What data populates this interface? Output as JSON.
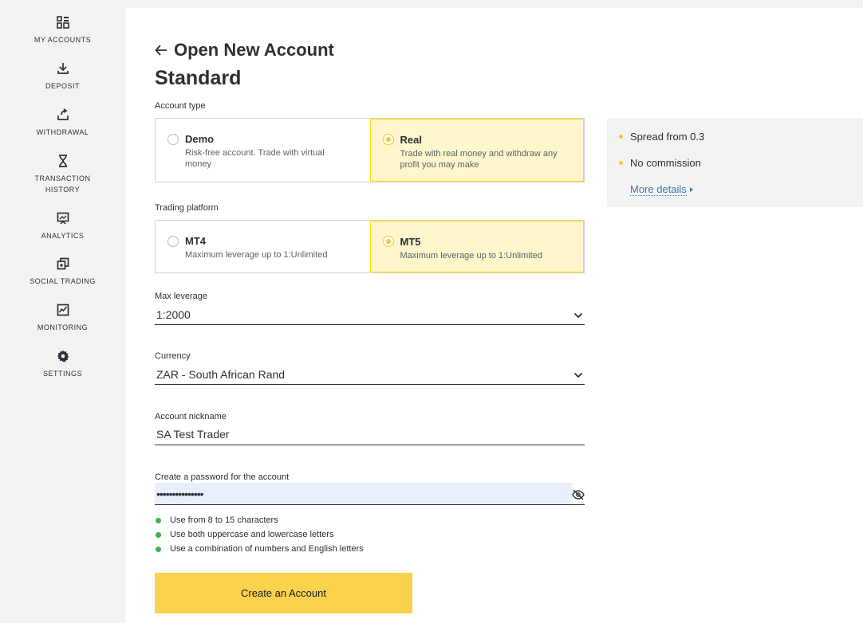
{
  "sidebar": {
    "items": [
      {
        "label": "MY ACCOUNTS",
        "icon": "grid-icon"
      },
      {
        "label": "DEPOSIT",
        "icon": "download-icon"
      },
      {
        "label": "WITHDRAWAL",
        "icon": "upload-icon"
      },
      {
        "label": "TRANSACTION HISTORY",
        "icon": "hourglass-icon"
      },
      {
        "label": "ANALYTICS",
        "icon": "presentation-chart-icon"
      },
      {
        "label": "SOCIAL TRADING",
        "icon": "copy-icon"
      },
      {
        "label": "MONITORING",
        "icon": "monitor-chart-icon"
      },
      {
        "label": "SETTINGS",
        "icon": "gear-icon"
      }
    ]
  },
  "header": {
    "title": "Open New Account",
    "subtitle": "Standard"
  },
  "account_type": {
    "label": "Account type",
    "options": [
      {
        "title": "Demo",
        "desc": "Risk-free account. Trade with virtual money",
        "selected": false
      },
      {
        "title": "Real",
        "desc": "Trade with real money and withdraw any profit you may make",
        "selected": true
      }
    ]
  },
  "platform": {
    "label": "Trading platform",
    "options": [
      {
        "title": "MT4",
        "desc": "Maximum leverage up to 1:Unlimited",
        "selected": false
      },
      {
        "title": "MT5",
        "desc": "Maximum leverage up to 1:Unlimited",
        "selected": true
      }
    ]
  },
  "leverage": {
    "label": "Max leverage",
    "value": "1:2000"
  },
  "currency": {
    "label": "Currency",
    "value": "ZAR - South African Rand"
  },
  "nickname": {
    "label": "Account nickname",
    "value": "SA Test Trader"
  },
  "password": {
    "label": "Create a password for the account",
    "value": "•••••••••••••••",
    "rules": [
      "Use from 8 to 15 characters",
      "Use both uppercase and lowercase letters",
      "Use a combination of numbers and English letters"
    ]
  },
  "submit": {
    "label": "Create an Account"
  },
  "info": {
    "bullets": [
      "Spread from 0.3",
      "No commission"
    ],
    "more": "More details"
  },
  "colors": {
    "accent": "#fad24c",
    "selected_bg": "#fff6cc",
    "rule_ok": "#3bb54a",
    "link": "#3b78b1"
  }
}
